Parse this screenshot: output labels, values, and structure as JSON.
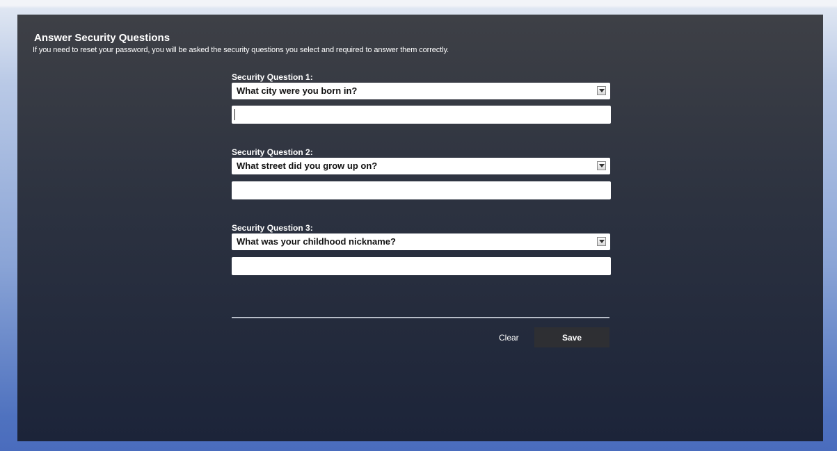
{
  "page": {
    "title": "Answer Security Questions",
    "subtitle": "If you need to reset your password, you will be asked the security questions you select and required to answer them correctly."
  },
  "questions": [
    {
      "label": "Security Question 1:",
      "selected_question": "What city were you born in?",
      "answer": ""
    },
    {
      "label": "Security Question 2:",
      "selected_question": "What street did you grow up on?",
      "answer": ""
    },
    {
      "label": "Security Question 3:",
      "selected_question": "What was your childhood nickname?",
      "answer": ""
    }
  ],
  "actions": {
    "clear_label": "Clear",
    "save_label": "Save"
  },
  "icons": {
    "dropdown": "chevron-down-icon"
  },
  "colors": {
    "panel_top": "#3e4046",
    "panel_bottom": "#1c2439",
    "page_background": "#4f72bf",
    "save_button": "#2e2f33",
    "text": "#ffffff"
  }
}
